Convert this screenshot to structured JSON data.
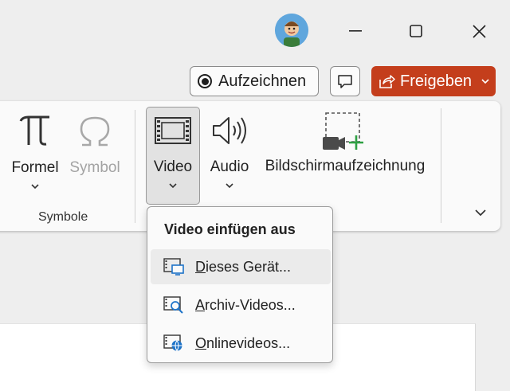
{
  "titlebar": {
    "avatar_icon": "user-avatar",
    "minimize_icon": "minimize-icon",
    "maximize_icon": "maximize-icon",
    "close_icon": "close-icon"
  },
  "actions": {
    "record_label": "Aufzeichnen",
    "share_label": "Freigeben",
    "share_color": "#c43e1c"
  },
  "ribbon": {
    "items": [
      {
        "id": "formel",
        "label": "Formel",
        "icon": "pi-icon",
        "disabled": false
      },
      {
        "id": "symbol",
        "label": "Symbol",
        "icon": "omega-icon",
        "disabled": true
      },
      {
        "id": "video",
        "label": "Video",
        "icon": "film-icon",
        "disabled": false
      },
      {
        "id": "audio",
        "label": "Audio",
        "icon": "speaker-icon",
        "disabled": false
      },
      {
        "id": "screenrec",
        "label": "Bildschirmaufzeichnung",
        "icon": "screen-recording-icon",
        "disabled": false
      }
    ],
    "group_label": "Symbole"
  },
  "video_menu": {
    "title": "Video einfügen aus",
    "items": [
      {
        "accesskey": "D",
        "rest": "ieses Gerät...",
        "icon": "device-video-icon"
      },
      {
        "accesskey": "A",
        "rest": "rchiv-Videos...",
        "icon": "stock-video-icon"
      },
      {
        "accesskey": "O",
        "rest": "nlinevideos...",
        "icon": "online-video-icon"
      }
    ]
  }
}
